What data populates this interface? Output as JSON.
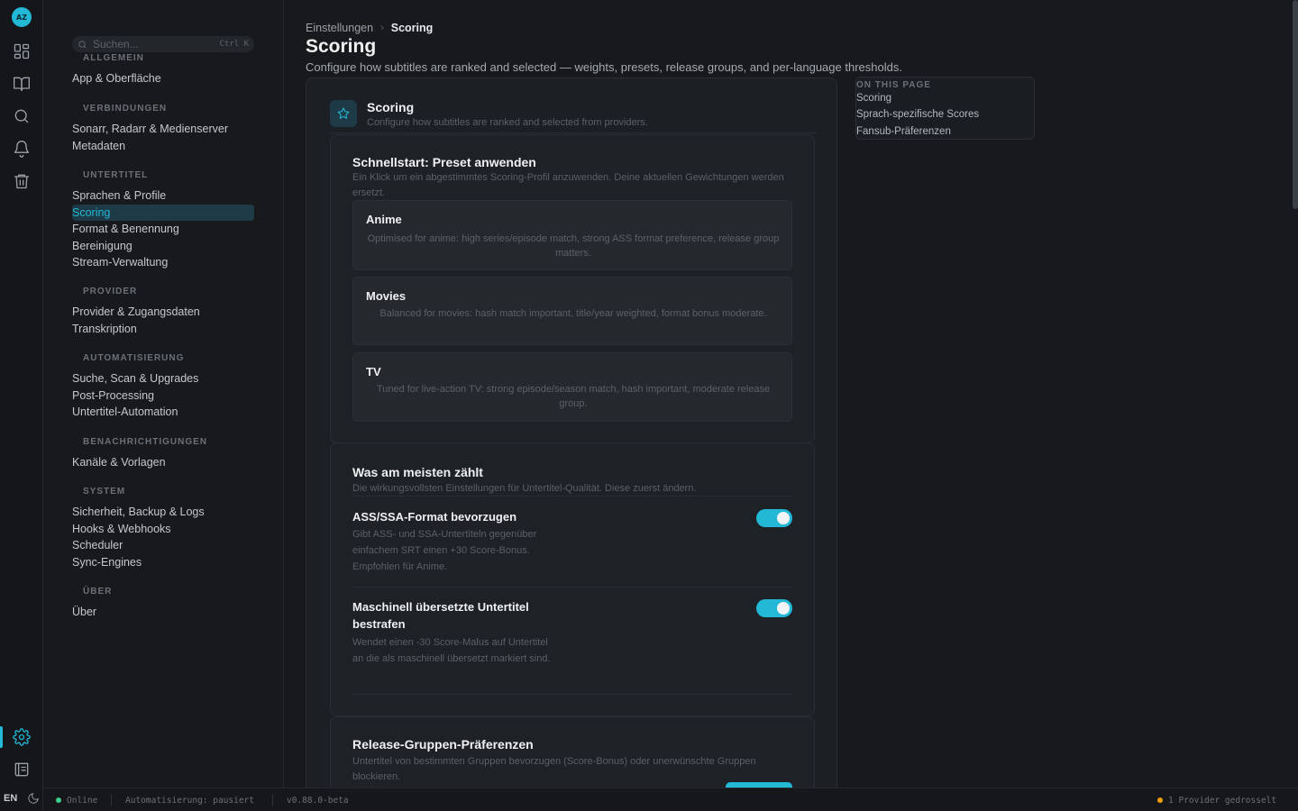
{
  "app": {
    "logo_text": "AZ"
  },
  "rail": {
    "icons": [
      "dashboard-icon",
      "library-icon",
      "search-icon",
      "bell-icon",
      "trash-icon",
      "gear-icon",
      "logs-icon"
    ],
    "lang": "EN"
  },
  "nav": {
    "search_placeholder": "Suchen...",
    "search_shortcut": "Ctrl K",
    "groups": [
      {
        "header": "ALLGEMEIN",
        "items": [
          "App & Oberfläche"
        ]
      },
      {
        "header": "VERBINDUNGEN",
        "items": [
          "Sonarr, Radarr & Medienserver",
          "Metadaten"
        ]
      },
      {
        "header": "UNTERTITEL",
        "items": [
          "Sprachen & Profile",
          "Scoring",
          "Format & Benennung",
          "Bereinigung",
          "Stream-Verwaltung"
        ]
      },
      {
        "header": "PROVIDER",
        "items": [
          "Provider & Zugangsdaten",
          "Transkription"
        ]
      },
      {
        "header": "AUTOMATISIERUNG",
        "items": [
          "Suche, Scan & Upgrades",
          "Post-Processing",
          "Untertitel-Automation"
        ]
      },
      {
        "header": "BENACHRICHTIGUNGEN",
        "items": [
          "Kanäle & Vorlagen"
        ]
      },
      {
        "header": "SYSTEM",
        "items": [
          "Sicherheit, Backup & Logs",
          "Hooks & Webhooks",
          "Scheduler",
          "Sync-Engines"
        ]
      },
      {
        "header": "ÜBER",
        "items": [
          "Über"
        ]
      }
    ],
    "active_item": "Scoring"
  },
  "breadcrumb": {
    "parent": "Einstellungen",
    "current": "Scoring"
  },
  "page": {
    "title": "Scoring",
    "description": "Configure how subtitles are ranked and selected — weights, presets, release groups, and per-language thresholds."
  },
  "card": {
    "title": "Scoring",
    "description": "Configure how subtitles are ranked and selected from providers."
  },
  "presets_section": {
    "title": "Schnellstart: Preset anwenden",
    "description": "Ein Klick um ein abgestimmtes Scoring-Profil anzuwenden. Deine aktuellen Gewichtungen werden ersetzt.",
    "presets": [
      {
        "name": "Anime",
        "description": "Optimised for anime: high series/episode match, strong ASS format preference, release group matters."
      },
      {
        "name": "Movies",
        "description": "Balanced for movies: hash match important, title/year weighted, format bonus moderate."
      },
      {
        "name": "TV",
        "description": "Tuned for live-action TV: strong episode/season match, hash important, moderate release group."
      }
    ]
  },
  "important_section": {
    "title": "Was am meisten zählt",
    "description": "Die wirkungsvollsten Einstellungen für Untertitel-Qualität. Diese zuerst ändern.",
    "options": [
      {
        "title": "ASS/SSA-Format bevorzugen",
        "description": "Gibt ASS- und SSA-Untertiteln gegenüber einfachem SRT einen +30 Score-Bonus. Empfohlen für Anime.",
        "enabled": true
      },
      {
        "title": "Maschinell übersetzte Untertitel bestrafen",
        "description": "Wendet einen -30 Score-Malus auf Untertitel an die als maschinell übersetzt markiert sind.",
        "enabled": true
      }
    ]
  },
  "release_section": {
    "title": "Release-Gruppen-Präferenzen",
    "description": "Untertitel von bestimmten Gruppen bevorzugen (Score-Bonus) oder unerwünschte Gruppen blockieren."
  },
  "toc": {
    "header": "ON THIS PAGE",
    "items": [
      "Scoring",
      "Sprach-spezifische Scores",
      "Fansub-Präferenzen"
    ]
  },
  "status": {
    "online": "Online",
    "automation": "Automatisierung: pausiert",
    "version": "v0.88.0-beta",
    "providers": "1 Provider gedrosselt",
    "online_color": "#3ecf8e",
    "warn_color": "#f59e0b"
  },
  "colors": {
    "accent": "#22b8d6",
    "background": "#17191d"
  }
}
